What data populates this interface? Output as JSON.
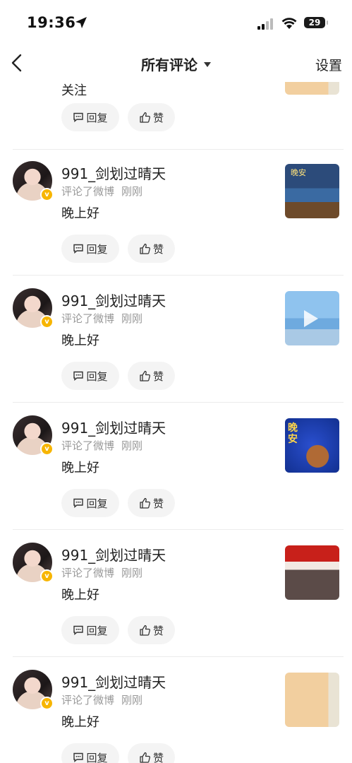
{
  "status_bar": {
    "time": "19:36",
    "battery": "29"
  },
  "nav": {
    "back_icon": "chevron-left-icon",
    "title": "所有评论",
    "settings": "设置"
  },
  "first_item": {
    "comment": "关注",
    "reply": "回复",
    "like": "赞"
  },
  "items": [
    {
      "name": "991_剑划过晴天",
      "action": "评论了微博",
      "time": "刚刚",
      "comment": "晚上好",
      "reply": "回复",
      "like": "赞",
      "thumb_text": "晚安"
    },
    {
      "name": "991_剑划过晴天",
      "action": "评论了微博",
      "time": "刚刚",
      "comment": "晚上好",
      "reply": "回复",
      "like": "赞"
    },
    {
      "name": "991_剑划过晴天",
      "action": "评论了微博",
      "time": "刚刚",
      "comment": "晚上好",
      "reply": "回复",
      "like": "赞",
      "thumb_text": "晚安"
    },
    {
      "name": "991_剑划过晴天",
      "action": "评论了微博",
      "time": "刚刚",
      "comment": "晚上好",
      "reply": "回复",
      "like": "赞"
    },
    {
      "name": "991_剑划过晴天",
      "action": "评论了微博",
      "time": "刚刚",
      "comment": "晚上好",
      "reply": "回复",
      "like": "赞"
    }
  ],
  "colors": {
    "verified_badge": "#f7b500",
    "pill_bg": "#f4f4f4",
    "meta_text": "#999999"
  }
}
